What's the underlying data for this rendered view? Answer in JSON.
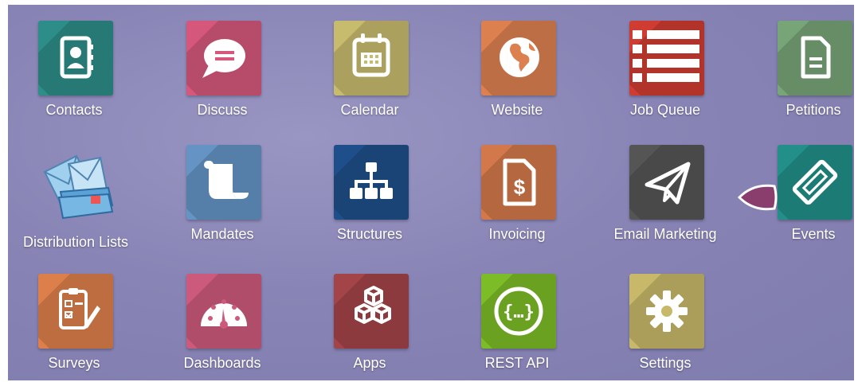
{
  "apps": [
    {
      "label": "Contacts",
      "icon": "contacts-book-icon",
      "color": "#2d8d89"
    },
    {
      "label": "Discuss",
      "icon": "chat-bubble-icon",
      "color": "#d5587c"
    },
    {
      "label": "Calendar",
      "icon": "calendar-icon",
      "color": "#c7bb6d"
    },
    {
      "label": "Website",
      "icon": "globe-icon",
      "color": "#dc8050"
    },
    {
      "label": "Job Queue",
      "icon": "list-icon",
      "color": "#cf3c32"
    },
    {
      "label": "Petitions",
      "icon": "document-icon",
      "color": "#77a577"
    },
    {
      "label": "Distribution Lists",
      "icon": "envelopes-icon",
      "color": "#7fb3d9"
    },
    {
      "label": "Mandates",
      "icon": "scroll-icon",
      "color": "#6493c4"
    },
    {
      "label": "Structures",
      "icon": "org-chart-icon",
      "color": "#1f4f8a"
    },
    {
      "label": "Invoicing",
      "icon": "invoice-dollar-icon",
      "color": "#d3784a"
    },
    {
      "label": "Email Marketing",
      "icon": "paper-plane-icon",
      "color": "#555555"
    },
    {
      "label": "Events",
      "icon": "ticket-icon",
      "color": "#229089"
    },
    {
      "label": "Surveys",
      "icon": "survey-clipboard-icon",
      "color": "#dc7f4a"
    },
    {
      "label": "Dashboards",
      "icon": "gauge-icon",
      "color": "#cc5a7c"
    },
    {
      "label": "Apps",
      "icon": "cubes-icon",
      "color": "#a34448"
    },
    {
      "label": "REST API",
      "icon": "api-braces-icon",
      "color": "#7cbc27"
    },
    {
      "label": "Settings",
      "icon": "gear-icon",
      "color": "#c8b86a"
    }
  ]
}
